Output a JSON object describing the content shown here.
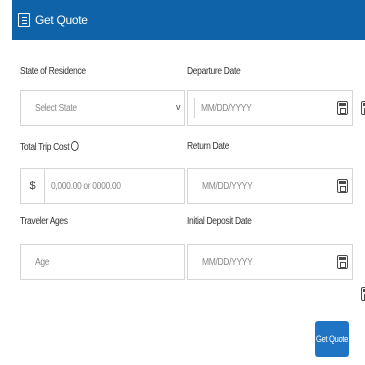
{
  "header": {
    "title": "Get Quote",
    "icon": "form-icon",
    "background": "#0f63a8"
  },
  "fields": {
    "state": {
      "label": "State of Residence",
      "placeholder": "Select State",
      "caret": "v"
    },
    "departure": {
      "label": "Departure Date",
      "placeholder": "MM/DD/YYYY"
    },
    "trip_cost": {
      "label": "Total Trip Cost",
      "currency": "$",
      "placeholder": "0,000.00 or 0000.00"
    },
    "return": {
      "label": "Return Date",
      "placeholder": "MM/DD/YYYY"
    },
    "ages": {
      "label": "Traveler Ages",
      "placeholder": "Age"
    },
    "deposit": {
      "label": "Initial Deposit Date",
      "placeholder": "MM/DD/YYYY"
    }
  },
  "submit": {
    "label": "Get Quote",
    "color": "#1f74c4"
  }
}
